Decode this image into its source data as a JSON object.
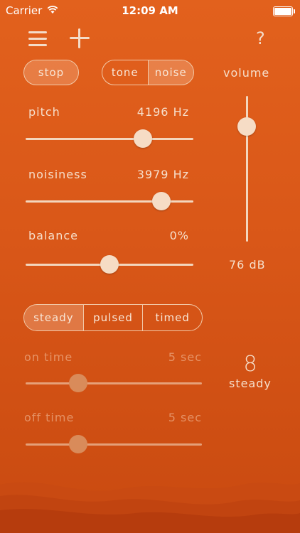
{
  "status_bar": {
    "carrier": "Carrier",
    "time": "12:09 AM"
  },
  "toolbar": {
    "help_label": "?"
  },
  "controls": {
    "stop_label": "stop",
    "sound_type": {
      "options": [
        "tone",
        "noise"
      ],
      "selected": "noise"
    },
    "volume_label": "volume",
    "volume_value": "76 dB",
    "volume_level": 0.8
  },
  "sliders": {
    "pitch": {
      "label": "pitch",
      "value": "4196 Hz",
      "position": 0.7
    },
    "noisiness": {
      "label": "noisiness",
      "value": "3979 Hz",
      "position": 0.81
    },
    "balance": {
      "label": "balance",
      "value": "0%",
      "position": 0.5
    }
  },
  "mode": {
    "options": [
      "steady",
      "pulsed",
      "timed"
    ],
    "selected": "steady",
    "indicator_number": "8",
    "indicator_label": "steady"
  },
  "timing": {
    "on_time": {
      "label": "on time",
      "value": "5 sec",
      "position": 0.3
    },
    "off_time": {
      "label": "off time",
      "value": "5 sec",
      "position": 0.3
    }
  }
}
